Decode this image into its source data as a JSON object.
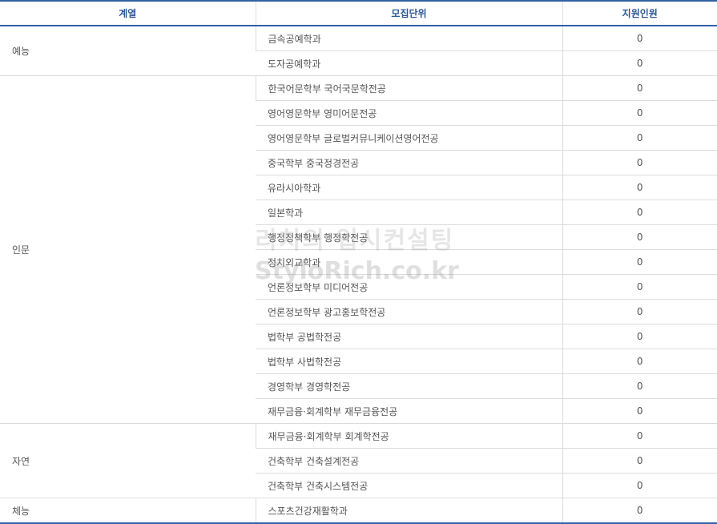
{
  "headers": {
    "category": "계열",
    "unit": "모집단위",
    "applicants": "지원인원"
  },
  "groups": [
    {
      "category": "예능",
      "rows": [
        {
          "unit": "금속공예학과",
          "applicants": "0"
        },
        {
          "unit": "도자공예학과",
          "applicants": "0"
        }
      ]
    },
    {
      "category": "인문",
      "rows": [
        {
          "unit": "한국어문학부 국어국문학전공",
          "applicants": "0"
        },
        {
          "unit": "영어영문학부 영미어문전공",
          "applicants": "0"
        },
        {
          "unit": "영어영문학부 글로벌커뮤니케이션영어전공",
          "applicants": "0"
        },
        {
          "unit": "중국학부 중국정경전공",
          "applicants": "0"
        },
        {
          "unit": "유라시아학과",
          "applicants": "0"
        },
        {
          "unit": "일본학과",
          "applicants": "0"
        },
        {
          "unit": "행정정책학부 행정학전공",
          "applicants": "0"
        },
        {
          "unit": "정치외교학과",
          "applicants": "0"
        },
        {
          "unit": "언론정보학부 미디어전공",
          "applicants": "0"
        },
        {
          "unit": "언론정보학부 광고홍보학전공",
          "applicants": "0"
        },
        {
          "unit": "법학부 공법학전공",
          "applicants": "0"
        },
        {
          "unit": "법학부 사법학전공",
          "applicants": "0"
        },
        {
          "unit": "경영학부 경영학전공",
          "applicants": "0"
        },
        {
          "unit": "재무금융·회계학부 재무금융전공",
          "applicants": "0"
        }
      ]
    },
    {
      "category": "자연",
      "rows": [
        {
          "unit": "재무금융·회계학부 회계학전공",
          "applicants": "0"
        },
        {
          "unit": "건축학부 건축설계전공",
          "applicants": "0"
        },
        {
          "unit": "건축학부 건축시스템전공",
          "applicants": "0"
        }
      ]
    },
    {
      "category": "체능",
      "rows": [
        {
          "unit": "스포츠건강재활학과",
          "applicants": "0"
        }
      ]
    }
  ],
  "watermark": {
    "line1": "리치의 입시컨설팅",
    "line2": "StyloRich.co.kr"
  }
}
